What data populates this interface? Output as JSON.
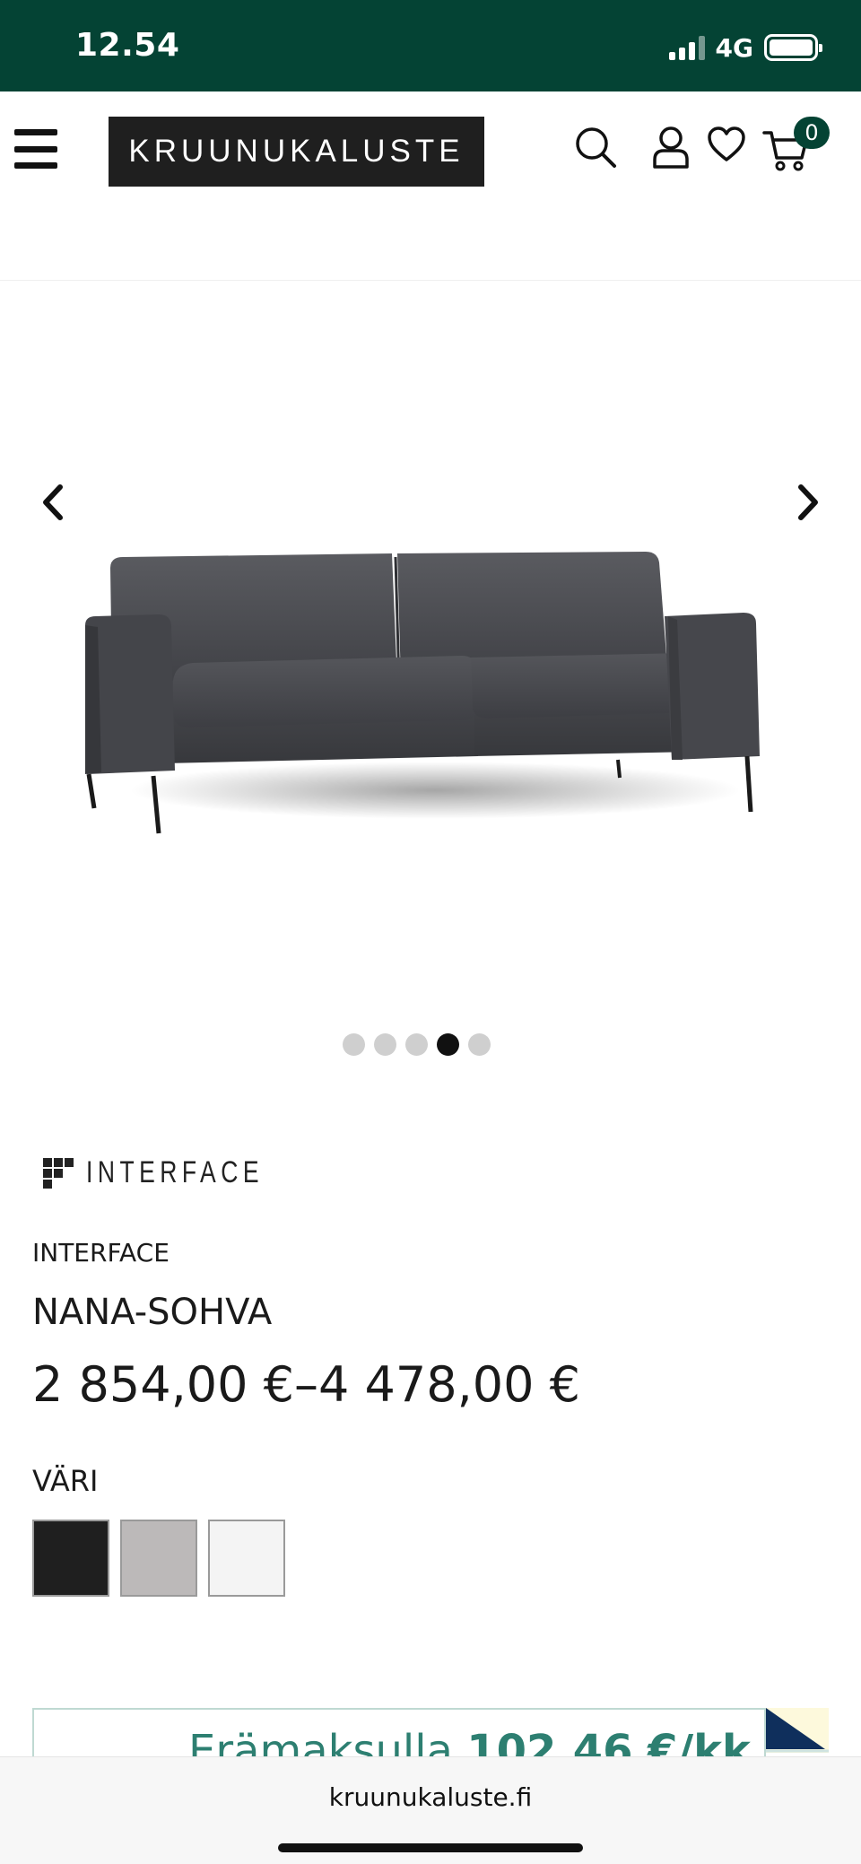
{
  "status_bar": {
    "time": "12.54",
    "network": "4G"
  },
  "header": {
    "logo_text": "KRUUNUKALUSTE",
    "cart_count": "0"
  },
  "gallery": {
    "slide_count": 5,
    "active_index": 3
  },
  "product": {
    "brand_logo_text": "INTERFACE",
    "brand": "INTERFACE",
    "title": "NANA-SOHVA",
    "price": "2 854,00 €–4 478,00 €",
    "color_label": "VÄRI",
    "swatches": [
      {
        "name": "black",
        "color": "#1f1f1f"
      },
      {
        "name": "grey",
        "color": "#bcb9b9"
      },
      {
        "name": "white",
        "color": "#f4f4f4"
      }
    ]
  },
  "finance": {
    "prefix": "Erämaksulla",
    "amount": "102,46 €/kk"
  },
  "browser": {
    "url": "kruunukaluste.fi"
  },
  "colors": {
    "brand_green": "#044334",
    "finance_green": "#2d7f71"
  }
}
